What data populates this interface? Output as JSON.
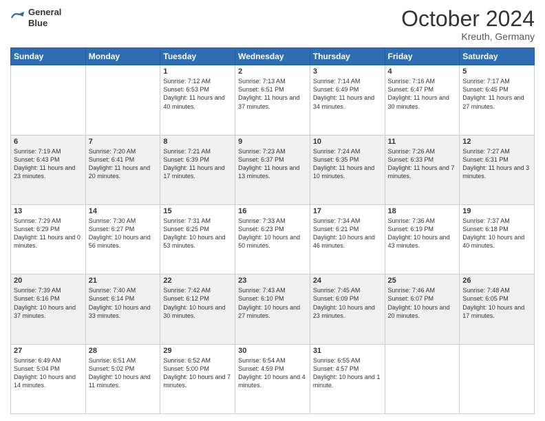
{
  "header": {
    "logo_line1": "General",
    "logo_line2": "Blue",
    "month_title": "October 2024",
    "location": "Kreuth, Germany"
  },
  "weekdays": [
    "Sunday",
    "Monday",
    "Tuesday",
    "Wednesday",
    "Thursday",
    "Friday",
    "Saturday"
  ],
  "rows": [
    [
      null,
      null,
      {
        "day": 1,
        "sunrise": "Sunrise: 7:12 AM",
        "sunset": "Sunset: 6:53 PM",
        "daylight": "Daylight: 11 hours and 40 minutes."
      },
      {
        "day": 2,
        "sunrise": "Sunrise: 7:13 AM",
        "sunset": "Sunset: 6:51 PM",
        "daylight": "Daylight: 11 hours and 37 minutes."
      },
      {
        "day": 3,
        "sunrise": "Sunrise: 7:14 AM",
        "sunset": "Sunset: 6:49 PM",
        "daylight": "Daylight: 11 hours and 34 minutes."
      },
      {
        "day": 4,
        "sunrise": "Sunrise: 7:16 AM",
        "sunset": "Sunset: 6:47 PM",
        "daylight": "Daylight: 11 hours and 30 minutes."
      },
      {
        "day": 5,
        "sunrise": "Sunrise: 7:17 AM",
        "sunset": "Sunset: 6:45 PM",
        "daylight": "Daylight: 11 hours and 27 minutes."
      }
    ],
    [
      {
        "day": 6,
        "sunrise": "Sunrise: 7:19 AM",
        "sunset": "Sunset: 6:43 PM",
        "daylight": "Daylight: 11 hours and 23 minutes."
      },
      {
        "day": 7,
        "sunrise": "Sunrise: 7:20 AM",
        "sunset": "Sunset: 6:41 PM",
        "daylight": "Daylight: 11 hours and 20 minutes."
      },
      {
        "day": 8,
        "sunrise": "Sunrise: 7:21 AM",
        "sunset": "Sunset: 6:39 PM",
        "daylight": "Daylight: 11 hours and 17 minutes."
      },
      {
        "day": 9,
        "sunrise": "Sunrise: 7:23 AM",
        "sunset": "Sunset: 6:37 PM",
        "daylight": "Daylight: 11 hours and 13 minutes."
      },
      {
        "day": 10,
        "sunrise": "Sunrise: 7:24 AM",
        "sunset": "Sunset: 6:35 PM",
        "daylight": "Daylight: 11 hours and 10 minutes."
      },
      {
        "day": 11,
        "sunrise": "Sunrise: 7:26 AM",
        "sunset": "Sunset: 6:33 PM",
        "daylight": "Daylight: 11 hours and 7 minutes."
      },
      {
        "day": 12,
        "sunrise": "Sunrise: 7:27 AM",
        "sunset": "Sunset: 6:31 PM",
        "daylight": "Daylight: 11 hours and 3 minutes."
      }
    ],
    [
      {
        "day": 13,
        "sunrise": "Sunrise: 7:29 AM",
        "sunset": "Sunset: 6:29 PM",
        "daylight": "Daylight: 11 hours and 0 minutes."
      },
      {
        "day": 14,
        "sunrise": "Sunrise: 7:30 AM",
        "sunset": "Sunset: 6:27 PM",
        "daylight": "Daylight: 10 hours and 56 minutes."
      },
      {
        "day": 15,
        "sunrise": "Sunrise: 7:31 AM",
        "sunset": "Sunset: 6:25 PM",
        "daylight": "Daylight: 10 hours and 53 minutes."
      },
      {
        "day": 16,
        "sunrise": "Sunrise: 7:33 AM",
        "sunset": "Sunset: 6:23 PM",
        "daylight": "Daylight: 10 hours and 50 minutes."
      },
      {
        "day": 17,
        "sunrise": "Sunrise: 7:34 AM",
        "sunset": "Sunset: 6:21 PM",
        "daylight": "Daylight: 10 hours and 46 minutes."
      },
      {
        "day": 18,
        "sunrise": "Sunrise: 7:36 AM",
        "sunset": "Sunset: 6:19 PM",
        "daylight": "Daylight: 10 hours and 43 minutes."
      },
      {
        "day": 19,
        "sunrise": "Sunrise: 7:37 AM",
        "sunset": "Sunset: 6:18 PM",
        "daylight": "Daylight: 10 hours and 40 minutes."
      }
    ],
    [
      {
        "day": 20,
        "sunrise": "Sunrise: 7:39 AM",
        "sunset": "Sunset: 6:16 PM",
        "daylight": "Daylight: 10 hours and 37 minutes."
      },
      {
        "day": 21,
        "sunrise": "Sunrise: 7:40 AM",
        "sunset": "Sunset: 6:14 PM",
        "daylight": "Daylight: 10 hours and 33 minutes."
      },
      {
        "day": 22,
        "sunrise": "Sunrise: 7:42 AM",
        "sunset": "Sunset: 6:12 PM",
        "daylight": "Daylight: 10 hours and 30 minutes."
      },
      {
        "day": 23,
        "sunrise": "Sunrise: 7:43 AM",
        "sunset": "Sunset: 6:10 PM",
        "daylight": "Daylight: 10 hours and 27 minutes."
      },
      {
        "day": 24,
        "sunrise": "Sunrise: 7:45 AM",
        "sunset": "Sunset: 6:09 PM",
        "daylight": "Daylight: 10 hours and 23 minutes."
      },
      {
        "day": 25,
        "sunrise": "Sunrise: 7:46 AM",
        "sunset": "Sunset: 6:07 PM",
        "daylight": "Daylight: 10 hours and 20 minutes."
      },
      {
        "day": 26,
        "sunrise": "Sunrise: 7:48 AM",
        "sunset": "Sunset: 6:05 PM",
        "daylight": "Daylight: 10 hours and 17 minutes."
      }
    ],
    [
      {
        "day": 27,
        "sunrise": "Sunrise: 6:49 AM",
        "sunset": "Sunset: 5:04 PM",
        "daylight": "Daylight: 10 hours and 14 minutes."
      },
      {
        "day": 28,
        "sunrise": "Sunrise: 6:51 AM",
        "sunset": "Sunset: 5:02 PM",
        "daylight": "Daylight: 10 hours and 11 minutes."
      },
      {
        "day": 29,
        "sunrise": "Sunrise: 6:52 AM",
        "sunset": "Sunset: 5:00 PM",
        "daylight": "Daylight: 10 hours and 7 minutes."
      },
      {
        "day": 30,
        "sunrise": "Sunrise: 6:54 AM",
        "sunset": "Sunset: 4:59 PM",
        "daylight": "Daylight: 10 hours and 4 minutes."
      },
      {
        "day": 31,
        "sunrise": "Sunrise: 6:55 AM",
        "sunset": "Sunset: 4:57 PM",
        "daylight": "Daylight: 10 hours and 1 minute."
      },
      null,
      null
    ]
  ]
}
